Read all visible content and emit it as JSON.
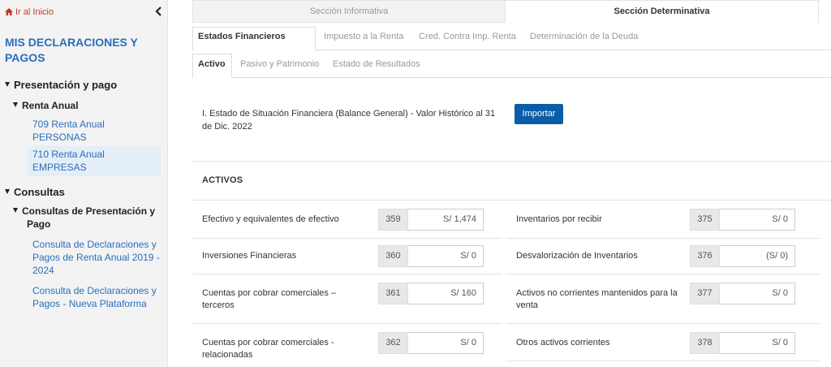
{
  "sidebar": {
    "back_label": "Ir al Inicio",
    "title": "MIS DECLARACIONES Y PAGOS",
    "sections": [
      {
        "label": "Presentación y pago",
        "sub": [
          {
            "label": "Renta Anual",
            "items": [
              "709 Renta Anual PERSONAS",
              "710 Renta Anual EMPRESAS"
            ]
          }
        ]
      },
      {
        "label": "Consultas",
        "sub": [
          {
            "label": "Consultas de Presentación y Pago",
            "items": [
              "Consulta de Declaraciones y Pagos de Renta Anual 2019 - 2024",
              "Consulta de Declaraciones y Pagos - Nueva Plataforma"
            ]
          }
        ]
      }
    ],
    "colors": {
      "link": "#2a6ebb",
      "back": "#c0392b"
    }
  },
  "top_tabs": [
    "Sección Informativa",
    "Sección Determinativa"
  ],
  "tabs": [
    "Estados Financieros",
    "Impuesto a la Renta",
    "Cred. Contra Imp. Renta",
    "Determinación de la Deuda"
  ],
  "subtabs": [
    "Activo",
    "Pasivo y Patrimonio",
    "Estado de Resultados"
  ],
  "section": {
    "title": "I. Estado de Situación Financiera (Balance General) - Valor Histórico al 31 de Dic. 2022",
    "import_label": "Importar",
    "activos_label": "ACTIVOS"
  },
  "items": [
    {
      "label": "Efectivo y equivalentes de efectivo",
      "code": "359",
      "value": "S/ 1,474"
    },
    {
      "label": "Inventarios por recibir",
      "code": "375",
      "value": "S/ 0"
    },
    {
      "label": "Inversiones Financieras",
      "code": "360",
      "value": "S/ 0"
    },
    {
      "label": "Desvalorización de Inventarios",
      "code": "376",
      "value": "(S/ 0)"
    },
    {
      "label": "Cuentas por cobrar comerciales – terceros",
      "code": "361",
      "value": "S/ 160"
    },
    {
      "label": "Activos no corrientes mantenidos para la venta",
      "code": "377",
      "value": "S/ 0"
    },
    {
      "label": "Cuentas por cobrar comerciales - relacionadas",
      "code": "362",
      "value": "S/ 0"
    },
    {
      "label": "Otros activos corrientes",
      "code": "378",
      "value": "S/ 0"
    }
  ],
  "icons": {
    "back": "home-icon",
    "collapse": "chevron-left-icon",
    "expanded": "triangle-down-icon"
  },
  "accent": "#0a5ea8"
}
